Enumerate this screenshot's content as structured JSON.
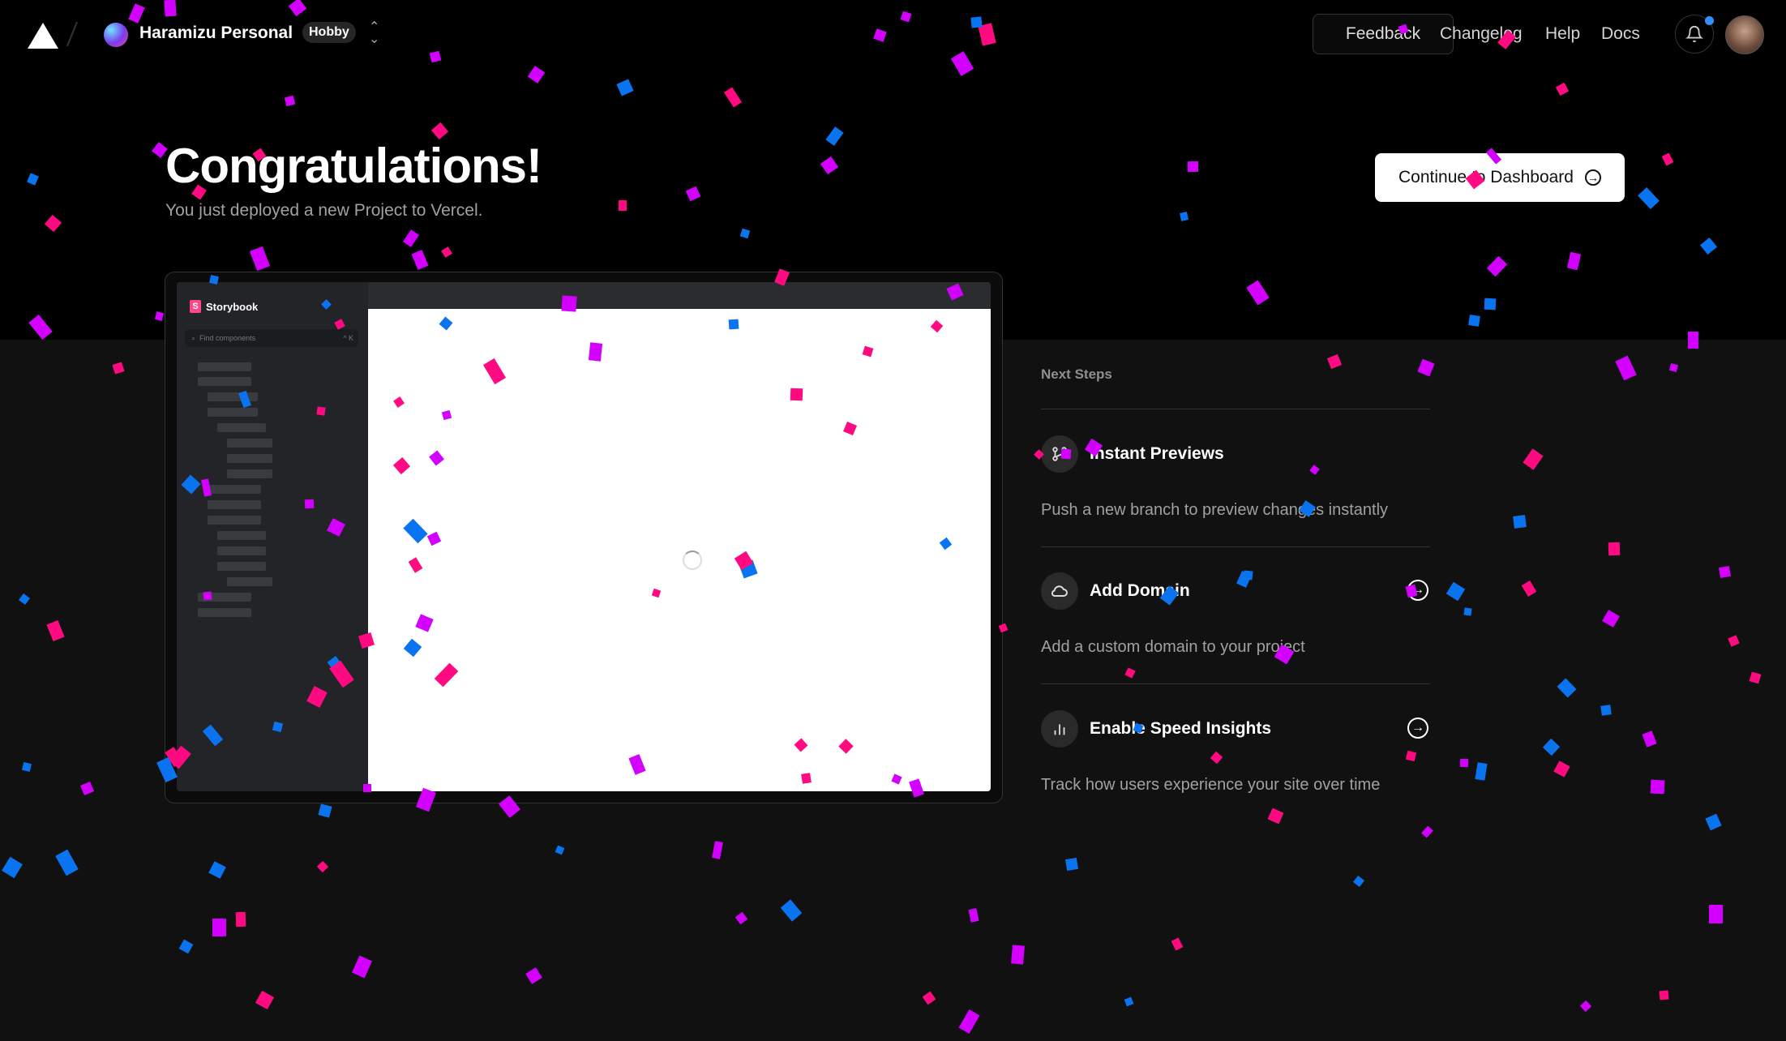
{
  "header": {
    "team_name": "Haramizu Personal",
    "plan": "Hobby",
    "feedback": "Feedback",
    "nav": [
      "Changelog",
      "Help",
      "Docs"
    ]
  },
  "hero": {
    "title": "Congratulations!",
    "subtitle": "You just deployed a new Project to Vercel.",
    "cta": "Continue to Dashboard"
  },
  "preview": {
    "app_name": "Storybook",
    "search_placeholder": "Find components",
    "search_shortcut": "^ K"
  },
  "next_steps": {
    "label": "Next Steps",
    "items": [
      {
        "title": "Instant Previews",
        "description": "Push a new branch to preview changes instantly",
        "icon": "git-branch-icon"
      },
      {
        "title": "Add Domain",
        "description": "Add a custom domain to your project",
        "icon": "cloud-icon"
      },
      {
        "title": "Enable Speed Insights",
        "description": "Track how users experience your site over time",
        "icon": "bar-chart-icon"
      }
    ]
  },
  "colors": {
    "confetti": [
      "#ff0a80",
      "#d400ff",
      "#0a74f0"
    ],
    "background": "#111112",
    "hero_background": "#000000"
  }
}
